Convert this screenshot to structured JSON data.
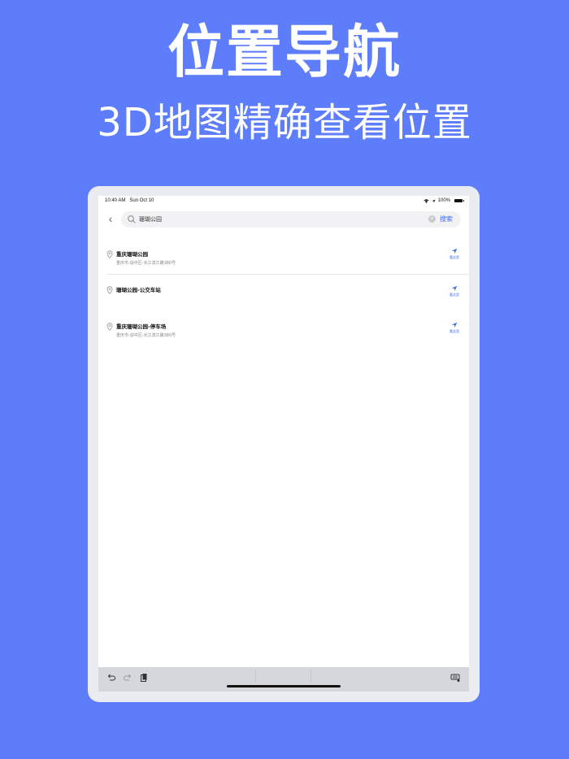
{
  "hero": {
    "title": "位置导航",
    "subtitle": "3D地图精确查看位置"
  },
  "status_bar": {
    "time": "10:40 AM",
    "date": "Sun Oct 10",
    "battery": "100%"
  },
  "search": {
    "back_icon": "chevron-left-icon",
    "value": "珊瑚公园",
    "button_label": "搜索"
  },
  "results": [
    {
      "name": "重庆珊瑚公园",
      "address": "重庆市-渝中区-长江滨江路380号",
      "action_label": "看这里"
    },
    {
      "name": "珊瑚公园-公交车站",
      "address": "",
      "action_label": "看这里"
    },
    {
      "name": "重庆珊瑚公园-停车场",
      "address": "重庆市-渝中区-长江滨江路380号",
      "action_label": "看这里"
    }
  ],
  "keyboard_bar": {
    "icons": [
      "undo-icon",
      "redo-icon",
      "paste-icon",
      "keyboard-dismiss-icon"
    ]
  },
  "colors": {
    "background": "#5e7dfb",
    "accent": "#3e6bf0"
  }
}
